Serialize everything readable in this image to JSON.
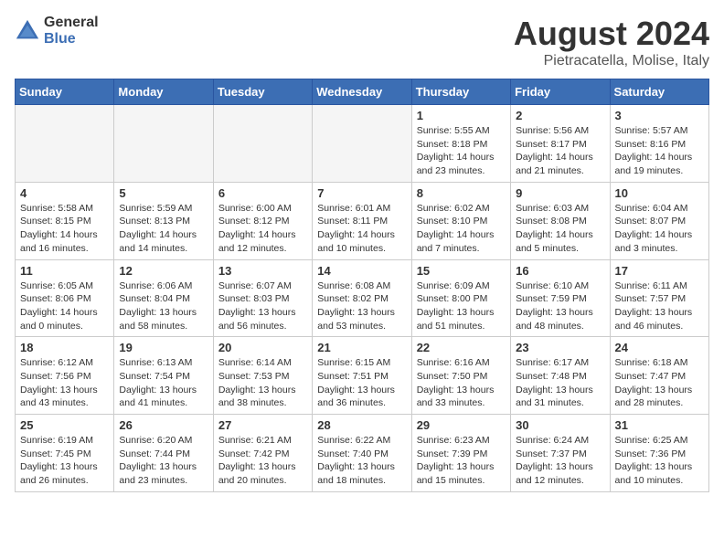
{
  "logo": {
    "general": "General",
    "blue": "Blue"
  },
  "title": "August 2024",
  "subtitle": "Pietracatella, Molise, Italy",
  "days_of_week": [
    "Sunday",
    "Monday",
    "Tuesday",
    "Wednesday",
    "Thursday",
    "Friday",
    "Saturday"
  ],
  "weeks": [
    [
      {
        "day": "",
        "info": "",
        "empty": true
      },
      {
        "day": "",
        "info": "",
        "empty": true
      },
      {
        "day": "",
        "info": "",
        "empty": true
      },
      {
        "day": "",
        "info": "",
        "empty": true
      },
      {
        "day": "1",
        "info": "Sunrise: 5:55 AM\nSunset: 8:18 PM\nDaylight: 14 hours\nand 23 minutes."
      },
      {
        "day": "2",
        "info": "Sunrise: 5:56 AM\nSunset: 8:17 PM\nDaylight: 14 hours\nand 21 minutes."
      },
      {
        "day": "3",
        "info": "Sunrise: 5:57 AM\nSunset: 8:16 PM\nDaylight: 14 hours\nand 19 minutes."
      }
    ],
    [
      {
        "day": "4",
        "info": "Sunrise: 5:58 AM\nSunset: 8:15 PM\nDaylight: 14 hours\nand 16 minutes."
      },
      {
        "day": "5",
        "info": "Sunrise: 5:59 AM\nSunset: 8:13 PM\nDaylight: 14 hours\nand 14 minutes."
      },
      {
        "day": "6",
        "info": "Sunrise: 6:00 AM\nSunset: 8:12 PM\nDaylight: 14 hours\nand 12 minutes."
      },
      {
        "day": "7",
        "info": "Sunrise: 6:01 AM\nSunset: 8:11 PM\nDaylight: 14 hours\nand 10 minutes."
      },
      {
        "day": "8",
        "info": "Sunrise: 6:02 AM\nSunset: 8:10 PM\nDaylight: 14 hours\nand 7 minutes."
      },
      {
        "day": "9",
        "info": "Sunrise: 6:03 AM\nSunset: 8:08 PM\nDaylight: 14 hours\nand 5 minutes."
      },
      {
        "day": "10",
        "info": "Sunrise: 6:04 AM\nSunset: 8:07 PM\nDaylight: 14 hours\nand 3 minutes."
      }
    ],
    [
      {
        "day": "11",
        "info": "Sunrise: 6:05 AM\nSunset: 8:06 PM\nDaylight: 14 hours\nand 0 minutes."
      },
      {
        "day": "12",
        "info": "Sunrise: 6:06 AM\nSunset: 8:04 PM\nDaylight: 13 hours\nand 58 minutes."
      },
      {
        "day": "13",
        "info": "Sunrise: 6:07 AM\nSunset: 8:03 PM\nDaylight: 13 hours\nand 56 minutes."
      },
      {
        "day": "14",
        "info": "Sunrise: 6:08 AM\nSunset: 8:02 PM\nDaylight: 13 hours\nand 53 minutes."
      },
      {
        "day": "15",
        "info": "Sunrise: 6:09 AM\nSunset: 8:00 PM\nDaylight: 13 hours\nand 51 minutes."
      },
      {
        "day": "16",
        "info": "Sunrise: 6:10 AM\nSunset: 7:59 PM\nDaylight: 13 hours\nand 48 minutes."
      },
      {
        "day": "17",
        "info": "Sunrise: 6:11 AM\nSunset: 7:57 PM\nDaylight: 13 hours\nand 46 minutes."
      }
    ],
    [
      {
        "day": "18",
        "info": "Sunrise: 6:12 AM\nSunset: 7:56 PM\nDaylight: 13 hours\nand 43 minutes."
      },
      {
        "day": "19",
        "info": "Sunrise: 6:13 AM\nSunset: 7:54 PM\nDaylight: 13 hours\nand 41 minutes."
      },
      {
        "day": "20",
        "info": "Sunrise: 6:14 AM\nSunset: 7:53 PM\nDaylight: 13 hours\nand 38 minutes."
      },
      {
        "day": "21",
        "info": "Sunrise: 6:15 AM\nSunset: 7:51 PM\nDaylight: 13 hours\nand 36 minutes."
      },
      {
        "day": "22",
        "info": "Sunrise: 6:16 AM\nSunset: 7:50 PM\nDaylight: 13 hours\nand 33 minutes."
      },
      {
        "day": "23",
        "info": "Sunrise: 6:17 AM\nSunset: 7:48 PM\nDaylight: 13 hours\nand 31 minutes."
      },
      {
        "day": "24",
        "info": "Sunrise: 6:18 AM\nSunset: 7:47 PM\nDaylight: 13 hours\nand 28 minutes."
      }
    ],
    [
      {
        "day": "25",
        "info": "Sunrise: 6:19 AM\nSunset: 7:45 PM\nDaylight: 13 hours\nand 26 minutes."
      },
      {
        "day": "26",
        "info": "Sunrise: 6:20 AM\nSunset: 7:44 PM\nDaylight: 13 hours\nand 23 minutes."
      },
      {
        "day": "27",
        "info": "Sunrise: 6:21 AM\nSunset: 7:42 PM\nDaylight: 13 hours\nand 20 minutes."
      },
      {
        "day": "28",
        "info": "Sunrise: 6:22 AM\nSunset: 7:40 PM\nDaylight: 13 hours\nand 18 minutes."
      },
      {
        "day": "29",
        "info": "Sunrise: 6:23 AM\nSunset: 7:39 PM\nDaylight: 13 hours\nand 15 minutes."
      },
      {
        "day": "30",
        "info": "Sunrise: 6:24 AM\nSunset: 7:37 PM\nDaylight: 13 hours\nand 12 minutes."
      },
      {
        "day": "31",
        "info": "Sunrise: 6:25 AM\nSunset: 7:36 PM\nDaylight: 13 hours\nand 10 minutes."
      }
    ]
  ]
}
